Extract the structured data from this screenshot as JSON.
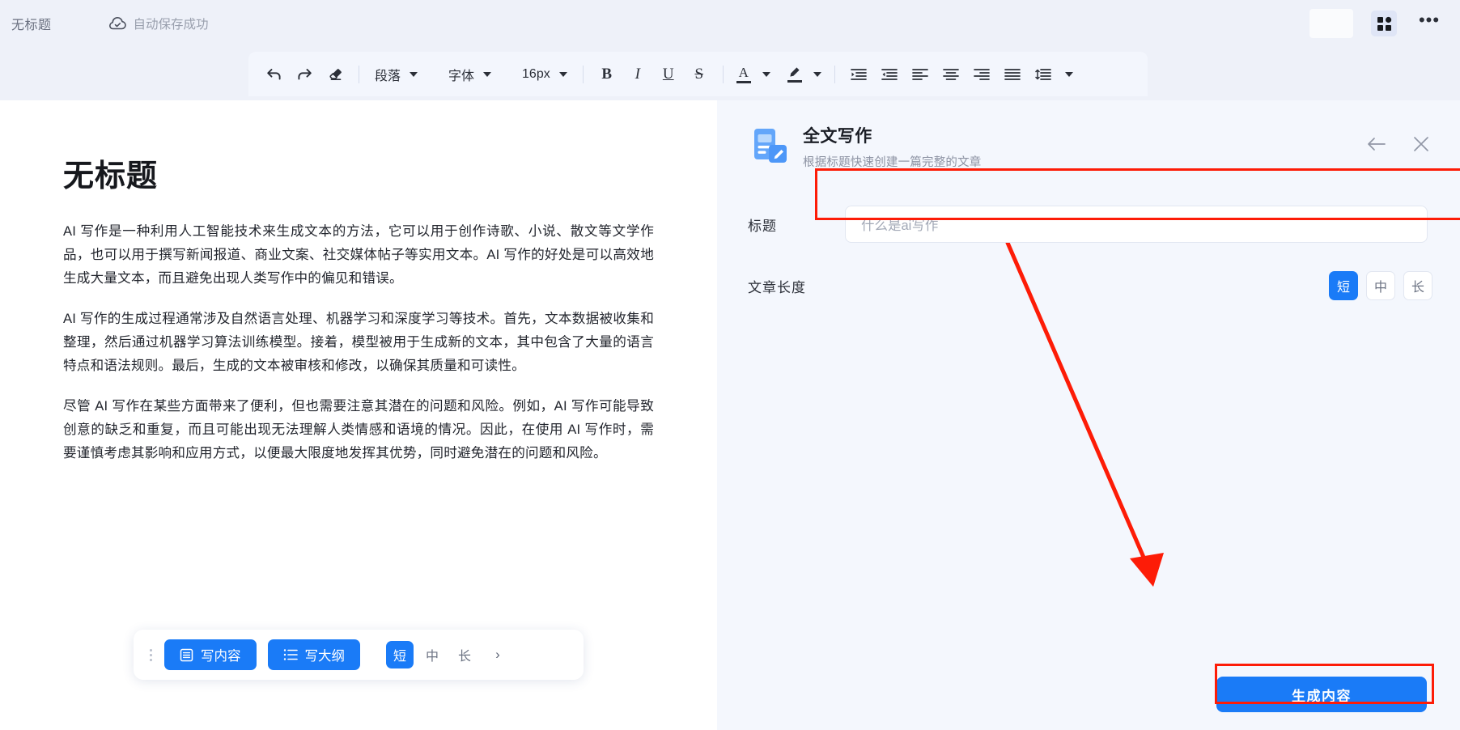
{
  "topbar": {
    "doc_title": "无标题",
    "autosave_text": "自动保存成功",
    "cloud_icon": "cloud-check-icon",
    "grid_icon": "apps-grid-icon",
    "more_label": "•••"
  },
  "toolbar": {
    "undo_icon": "undo-arrow-icon",
    "redo_icon": "redo-arrow-icon",
    "clear_format_icon": "clear-format-eraser-icon",
    "paragraph_label": "段落",
    "font_label": "字体",
    "font_size_label": "16px",
    "bold_label": "B",
    "italic_label": "I",
    "underline_label": "U",
    "strike_label": "S",
    "text_color_label": "A",
    "highlight_icon": "highlighter-pen-icon",
    "indent_increase_icon": "indent-increase-icon",
    "indent_decrease_icon": "indent-decrease-icon",
    "align_left_icon": "align-left-icon",
    "align_center_icon": "align-center-icon",
    "align_right_icon": "align-right-icon",
    "align_justify_icon": "align-justify-icon",
    "line_spacing_icon": "line-spacing-icon"
  },
  "document": {
    "title": "无标题",
    "paragraphs": [
      "AI 写作是一种利用人工智能技术来生成文本的方法，它可以用于创作诗歌、小说、散文等文学作品，也可以用于撰写新闻报道、商业文案、社交媒体帖子等实用文本。AI 写作的好处是可以高效地生成大量文本，而且避免出现人类写作中的偏见和错误。",
      "AI 写作的生成过程通常涉及自然语言处理、机器学习和深度学习等技术。首先，文本数据被收集和整理，然后通过机器学习算法训练模型。接着，模型被用于生成新的文本，其中包含了大量的语言特点和语法规则。最后，生成的文本被审核和修改，以确保其质量和可读性。",
      "尽管 AI 写作在某些方面带来了便利，但也需要注意其潜在的问题和风险。例如，AI 写作可能导致创意的缺乏和重复，而且可能出现无法理解人类情感和语境的情况。因此，在使用 AI 写作时，需要谨慎考虑其影响和应用方式，以便最大限度地发挥其优势，同时避免潜在的问题和风险。"
    ]
  },
  "float_toolbar": {
    "drag_handle": "drag-dots-handle",
    "write_content_label": "写内容",
    "write_content_icon": "document-icon",
    "write_outline_label": "写大纲",
    "write_outline_icon": "list-icon",
    "lengths": [
      "短",
      "中",
      "长"
    ],
    "selected_length": "短",
    "next_label": "›"
  },
  "panel": {
    "icon": "doc-pencil-icon",
    "title": "全文写作",
    "subtitle": "根据标题快速创建一篇完整的文章",
    "back_icon": "arrow-left-icon",
    "close_icon": "close-x-icon",
    "title_field": {
      "label": "标题",
      "placeholder": "什么是ai写作",
      "value": "什么是ai写作"
    },
    "length_field": {
      "label": "文章长度",
      "options": [
        "短",
        "中",
        "长"
      ],
      "selected": "短"
    },
    "generate_button": "生成内容"
  },
  "annotations": {
    "highlight_color": "#fd1c07",
    "arrow": "red-arrow-pointing-to-generate-button"
  },
  "colors": {
    "accent_blue": "#1a7bf7",
    "page_background": "#eef1f9",
    "panel_background": "#f4f7fd",
    "document_background": "#ffffff",
    "annotation_red": "#fd1c07"
  }
}
